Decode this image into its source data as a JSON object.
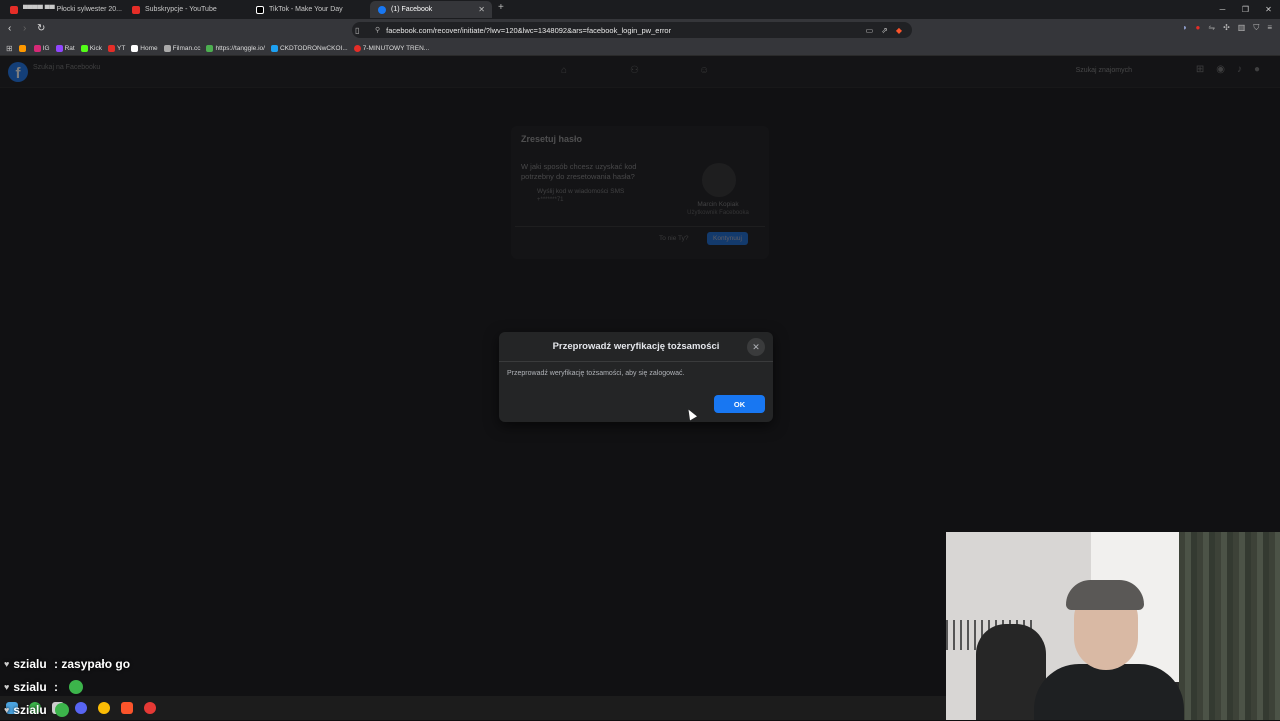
{
  "browser": {
    "tabs": [
      {
        "label": "▀▀▀▀ ▀▀ Płocki sylwester 20...",
        "color": "#e52d27"
      },
      {
        "label": "Subskrypcje - YouTube",
        "color": "#e52d27"
      },
      {
        "label": "TikTok - Make Your Day",
        "color": "#ffffff"
      },
      {
        "label": "(1) Facebook",
        "color": "#1877f2"
      }
    ],
    "url": "facebook.com/recover/initiate/?lwv=120&lwc=1348092&ars=facebook_login_pw_error",
    "bookmarks": [
      {
        "label": "",
        "color": "#ff9900"
      },
      {
        "label": "IG",
        "color": "#d62976"
      },
      {
        "label": "Rat",
        "color": "#9146ff"
      },
      {
        "label": "Kick",
        "color": "#53fc18"
      },
      {
        "label": "YT",
        "color": "#e52d27"
      },
      {
        "label": "Home",
        "color": "#ffffff"
      },
      {
        "label": "Filman.cc",
        "color": "#aaaaaa"
      },
      {
        "label": "https://tanggle.io/",
        "color": "#4caf50"
      },
      {
        "label": "CKDTODRONwCKOI...",
        "color": "#1da1f2"
      },
      {
        "label": "7-MINUTOWY TREN...",
        "color": "#e52d27"
      }
    ]
  },
  "facebook": {
    "search_placeholder": "Szukaj na Facebooku",
    "find_friends": "Szukaj znajomych",
    "recover": {
      "title": "Zresetuj hasło",
      "question": "W jaki sposób chcesz uzyskać kod potrzebny do zresetowania hasła?",
      "option": "Wyślij kod w wiadomości SMS",
      "option_masked": "+*******71",
      "user_name": "Marcin Kopiak",
      "user_sub": "Użytkownik Facebooka",
      "not_you": "To nie Ty?",
      "continue": "Kontynuuj"
    }
  },
  "dialog": {
    "title": "Przeprowadź weryfikację tożsamości",
    "message": "Przeprowadź weryfikację tożsamości, aby się zalogować.",
    "ok_label": "OK"
  },
  "chat": [
    {
      "user": "szialu",
      "text": " : zasypało go"
    },
    {
      "user": "szialu",
      "text": " : "
    },
    {
      "user": "szialu",
      "text": ""
    }
  ],
  "colors": {
    "accent": "#1877f2",
    "modal_bg": "#242526"
  }
}
